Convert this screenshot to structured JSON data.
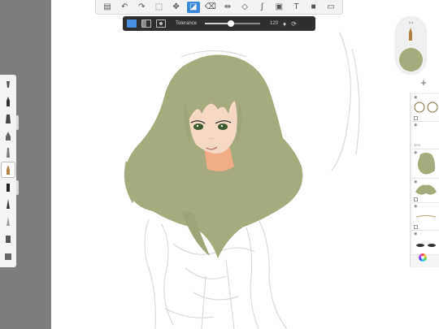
{
  "toolbar": {
    "items": [
      {
        "name": "gallery-icon",
        "glyph": "▤"
      },
      {
        "name": "undo-icon",
        "glyph": "↶"
      },
      {
        "name": "redo-icon",
        "glyph": "↷"
      },
      {
        "name": "selection-icon",
        "glyph": "⬚"
      },
      {
        "name": "transform-icon",
        "glyph": "✥"
      },
      {
        "name": "fill-icon",
        "glyph": "◪",
        "active": true
      },
      {
        "name": "eraser-icon",
        "glyph": "⌫"
      },
      {
        "name": "symmetry-icon",
        "glyph": "⇹"
      },
      {
        "name": "shapes-icon",
        "glyph": "◇"
      },
      {
        "name": "curve-icon",
        "glyph": "∫"
      },
      {
        "name": "image-icon",
        "glyph": "▣"
      },
      {
        "name": "text-icon",
        "glyph": "T"
      },
      {
        "name": "video-icon",
        "glyph": "■"
      },
      {
        "name": "fullscreen-icon",
        "glyph": "▭"
      }
    ]
  },
  "fill_options": {
    "label": "Tolerance",
    "tolerance_value": "120",
    "tolerance_fraction": 0.47,
    "modes": [
      "fill-mode-icon",
      "gradient-mode-icon",
      "radial-mode-icon"
    ]
  },
  "puck": {
    "brush_size": "5.4",
    "current_color": "#a5ab7c"
  },
  "layers": {
    "add_label": "+",
    "opacity_label": "80%"
  },
  "colors": {
    "hair": "#a5ab7c",
    "hair_dark": "#8f9468",
    "skin": "#f6d9c5",
    "neck": "#f1ad86",
    "eyes": "#3c5a32",
    "sketch": "#d8d8d8",
    "left_gutter": "#7d7d7d"
  }
}
